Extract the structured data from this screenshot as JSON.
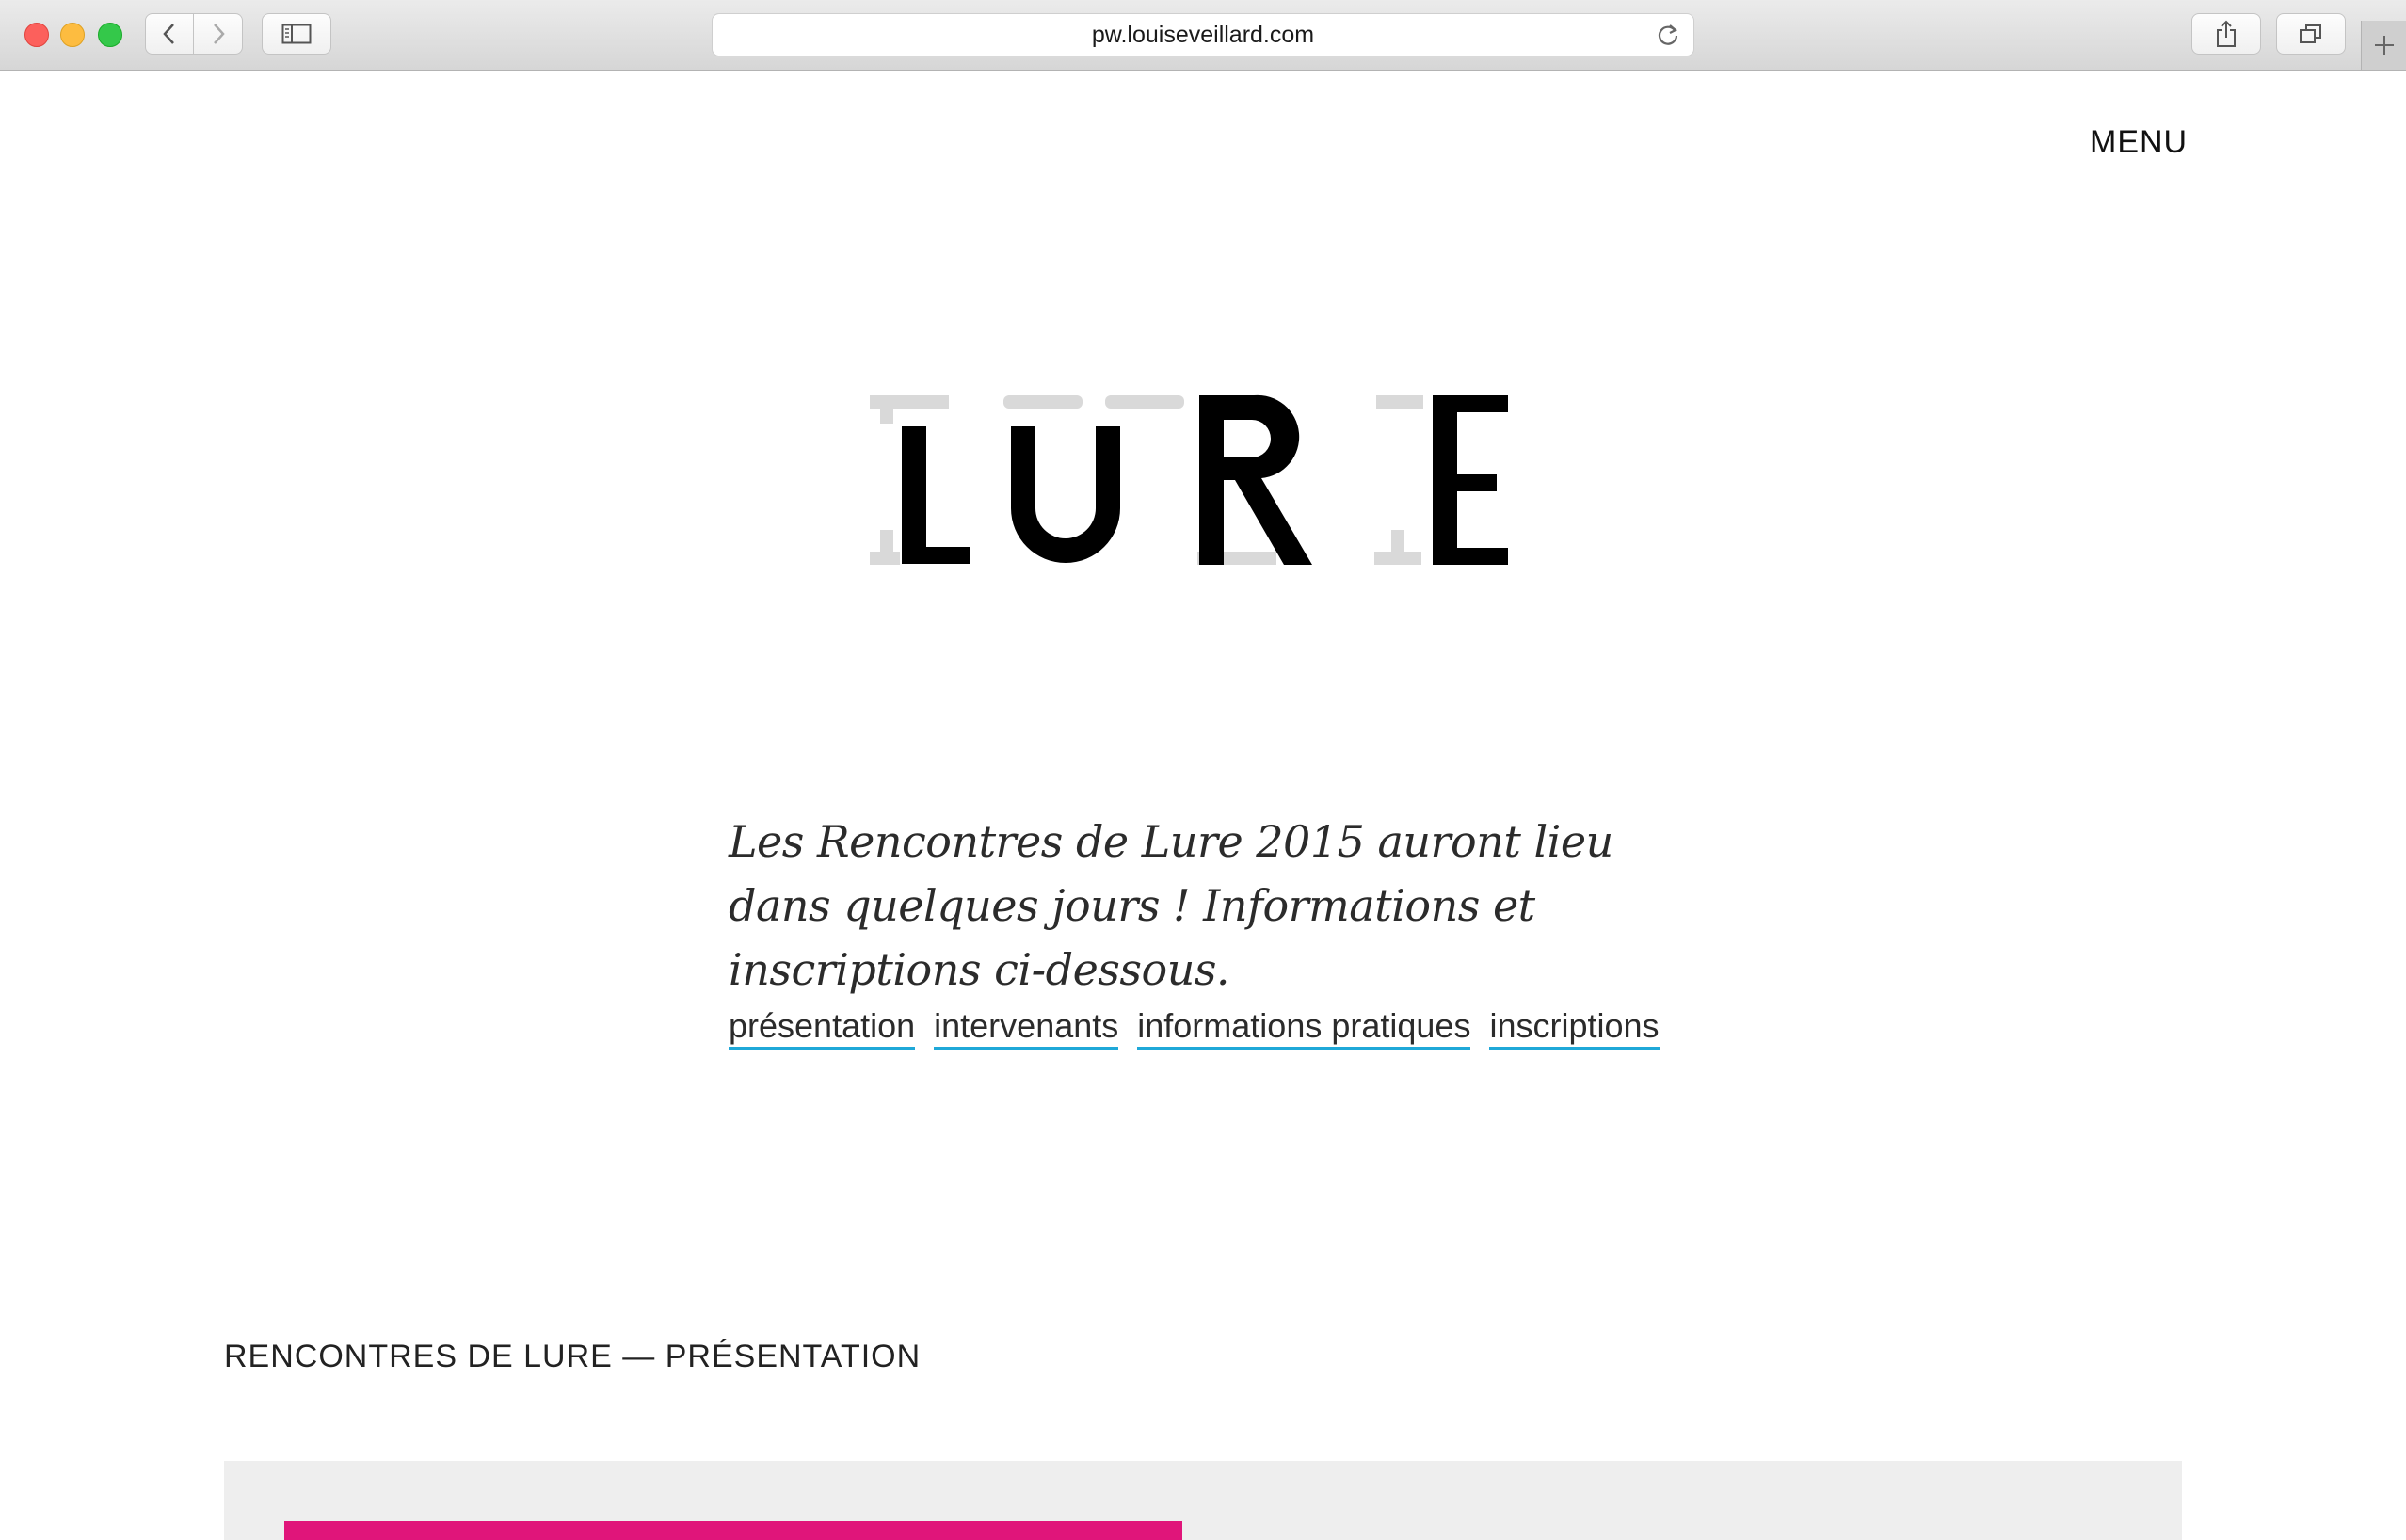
{
  "browser": {
    "url": "pw.louiseveillard.com"
  },
  "header": {
    "menu_label": "MENU"
  },
  "logo": {
    "text": "LURE"
  },
  "intro": {
    "text": "Les Rencontres de Lure 2015 auront lieu dans quelques jours ! Informations et inscriptions ci-dessous."
  },
  "links": [
    {
      "label": "présentation"
    },
    {
      "label": "intervenants"
    },
    {
      "label": "informations pratiques"
    },
    {
      "label": "inscriptions"
    }
  ],
  "section": {
    "title": "RENCONTRES DE LURE — PRÉSENTATION"
  },
  "colors": {
    "link_underline": "#1fa8d8",
    "accent_pink": "#e0157a",
    "panel_grey": "#eeeeee"
  }
}
